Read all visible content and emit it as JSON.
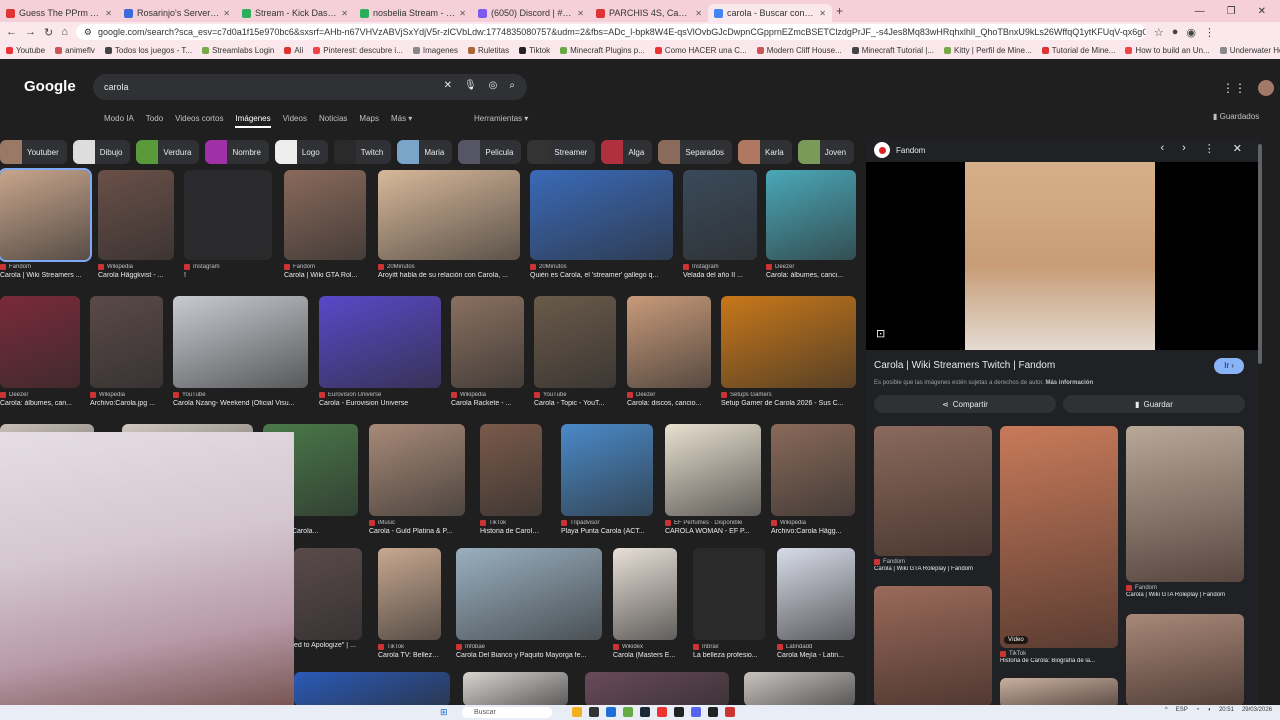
{
  "browser": {
    "tabs": [
      {
        "title": "Guess The PPrm Actors in 30 Se",
        "color": "#e03434"
      },
      {
        "title": "Rosarinjo's Server - Main Page",
        "color": "#3a6bd8"
      },
      {
        "title": "Stream - Kick Dashboard",
        "color": "#2ab05a"
      },
      {
        "title": "nosbelia Stream - Watch Live o",
        "color": "#2ab05a"
      },
      {
        "title": "(6050) Discord | # - Rosarin",
        "color": "#7a5af0"
      },
      {
        "title": "PARCHIS 4S, Casi ARENA",
        "color": "#e03434"
      },
      {
        "title": "carola - Buscar con Google",
        "color": "#4285f4"
      }
    ],
    "new_tab": "+",
    "url": "google.com/search?sca_esv=c7d0a1f15e970bc6&sxsrf=AHb-n67VHVzABVjSxYdjV5r-zlCVbLdw:1774835080757&udm=2&fbs=ADc_l-bpk8W4E-qsVlOvbGJcDwpnCGpprnEZmcBSETClzdgPrJF_-s4Jes8Mq83wHRqhxlhlI_QhoTBnxU9kLs26WffqQ1ytKFUqV-qx6gQpiCpb1lSQ-8O8DB3rHeo8L7I.DGeFruGiaEceOCuQMmuwUKSB093uK...",
    "bookmarks": [
      "Youtube",
      "animeflv",
      "Todos los juegos - T...",
      "Streamlabs Login",
      "Ali",
      "Pinterest: descubre i...",
      "Imagenes",
      "Ruletitas",
      "Tiktok",
      "Minecraft Plugins p...",
      "Como HACER una C...",
      "Modern Cliff House...",
      "Minecraft Tutorial |...",
      "Kitty | Perfil de Mine...",
      "Tutorial de Mine...",
      "How to build an Un...",
      "Underwater House..."
    ],
    "all_bookmarks": "Todos los marcadores"
  },
  "google": {
    "logo": "Google",
    "query": "carola",
    "nav": [
      "Modo IA",
      "Todo",
      "Videos cortos",
      "Imágenes",
      "Videos",
      "Noticias",
      "Maps",
      "Más ▾"
    ],
    "active_nav": "Imágenes",
    "tools": "Herramientas ▾",
    "saved": "Guardados",
    "chips": [
      {
        "label": "Youtuber",
        "color": "#9a7a66"
      },
      {
        "label": "Dibujo",
        "color": "#ddd"
      },
      {
        "label": "Verdura",
        "color": "#5a9a3a"
      },
      {
        "label": "Nombre",
        "color": "#a030a8"
      },
      {
        "label": "Logo",
        "color": "#eee"
      },
      {
        "label": "Twitch",
        "color": "#2a2a2a"
      },
      {
        "label": "Maria",
        "color": "#7aa4c8"
      },
      {
        "label": "Pelicula",
        "color": "#556"
      },
      {
        "label": "Streamer",
        "color": "#333"
      },
      {
        "label": "Alga",
        "color": "#b03040"
      },
      {
        "label": "Separados",
        "color": "#8a6a5a"
      },
      {
        "label": "Karla",
        "color": "#b07860"
      },
      {
        "label": "Joven",
        "color": "#7a9a5a"
      }
    ]
  },
  "results": [
    {
      "source": "Fandom",
      "caption": "Carola | Wiki Streamers ...",
      "color": "#c8a58c",
      "selected": true
    },
    {
      "source": "Wikipedia",
      "caption": "Carola Häggkvist - ...",
      "color": "#6a5048"
    },
    {
      "source": "Instagram",
      "caption": "!",
      "color": "#2a2a2e"
    },
    {
      "source": "Fandom",
      "caption": "Carola | Wiki GTA Rol...",
      "color": "#8a6a5c"
    },
    {
      "source": "20Minutos",
      "caption": "Aroyitt habla de su relación con Carola, ...",
      "color": "#d8b89a"
    },
    {
      "source": "20Minutos",
      "caption": "Quién es Carola, el 'streamer' gallego q...",
      "color": "#3a6ab8"
    },
    {
      "source": "Instagram",
      "caption": "Velada del año II ...",
      "color": "#3a4a5a"
    },
    {
      "source": "Deezer",
      "caption": "Carola: álbumes, canci...",
      "color": "#4aa8b8"
    },
    {
      "source": "Deezer",
      "caption": "Carola: álbumes, can...",
      "color": "#7a2a3a"
    },
    {
      "source": "Wikipedia",
      "caption": "Archivo:Carola.jpg ...",
      "color": "#5a4a48"
    },
    {
      "source": "YouTube",
      "caption": "Carola Nzang- Weekend (Oficial Visu...",
      "color": "#c8ccd2"
    },
    {
      "source": "Eurovision Universe",
      "caption": "Carola - Eurovision Universe",
      "color": "#5a48c8"
    },
    {
      "source": "Wikipedia",
      "caption": "Carola Rackete - ...",
      "color": "#8a7060"
    },
    {
      "source": "YouTube",
      "caption": "Carola - Topic - YouT...",
      "color": "#6a5a4a"
    },
    {
      "source": "Deezer",
      "caption": "Carola: discos, cancio...",
      "color": "#c89a7a"
    },
    {
      "source": "Setups Gamers",
      "caption": "Setup Gamer de Carola 2026 - Sus C...",
      "color": "#c8781a"
    },
    {
      "source": "",
      "caption": "",
      "color": "#c8c0b8"
    },
    {
      "source": "",
      "caption": "",
      "color": "#d0c8c0"
    },
    {
      "source": "Tok",
      "caption": "omán (@Carola...",
      "color": "#4a7a4a"
    },
    {
      "source": "iMusic",
      "caption": "Carola - Guld Platina & P...",
      "color": "#a88a78"
    },
    {
      "source": "TikTok",
      "caption": "Historia de Carola:...",
      "color": "#7a5a4a"
    },
    {
      "source": "Tripadvisor",
      "caption": "Playa Punta Carola (ACT...",
      "color": "#4a8ac8"
    },
    {
      "source": "EF Perfumes · Disponible",
      "caption": "CAROLA WOMAN - EF P...",
      "color": "#e8e0d0"
    },
    {
      "source": "Wikipedia",
      "caption": "Archivo:Carola Hägg...",
      "color": "#8a6a5a"
    },
    {
      "source": "",
      "caption": "ed to Apologize\" | ...",
      "color": "#5a4a4a"
    },
    {
      "source": "TikTok",
      "caption": "Carola TV: Belleza...",
      "color": "#c8a890"
    },
    {
      "source": "Infobae",
      "caption": "Carola Del Bianco y Paquito Mayorga fe...",
      "color": "#9ab0c0"
    },
    {
      "source": "Wikidex",
      "caption": "Carola (Masters E...",
      "color": "#e8e0d8"
    },
    {
      "source": "Inbrax",
      "caption": "La belleza profesio...",
      "color": "#2a2a2a"
    },
    {
      "source": "Latindadd",
      "caption": "Carola Mejía - Latin...",
      "color": "#d8dce8"
    },
    {
      "source": "",
      "caption": "",
      "color": "#2a5ab8"
    },
    {
      "source": "",
      "caption": "",
      "color": "#d8d4d0"
    },
    {
      "source": "",
      "caption": "",
      "color": "#6a4a5a"
    },
    {
      "source": "",
      "caption": "",
      "color": "#c8c4c0"
    }
  ],
  "panel": {
    "site": "Fandom",
    "title": "Carola | Wiki Streamers Twitch | Fandom",
    "visit": "Ir",
    "note": "Es posible que las imágenes estén sujetas a derechos de autor.",
    "more_info": "Más información",
    "share": "Compartir",
    "save": "Guardar",
    "related": [
      {
        "source": "Fandom",
        "caption": "Carola | Wiki GTA Roleplay | Fandom",
        "color": "#8a6a5c",
        "badge": ""
      },
      {
        "source": "TikTok",
        "caption": "Historia de Carola: Biografía de la...",
        "color": "#c87a5a",
        "badge": "Vídeo"
      },
      {
        "source": "Fandom",
        "caption": "Carola | Wiki GTA Roleplay | Fandom",
        "color": "#b8a898",
        "badge": ""
      },
      {
        "source": "",
        "caption": "",
        "color": "#9a6a5a",
        "badge": ""
      },
      {
        "source": "",
        "caption": "",
        "color": "#c8b0a0",
        "badge": ""
      },
      {
        "source": "",
        "caption": "",
        "color": "#a88878",
        "badge": ""
      }
    ]
  },
  "taskbar": {
    "search": "Buscar",
    "lang": "ESP",
    "time": "20:51",
    "date": "29/03/2026"
  }
}
